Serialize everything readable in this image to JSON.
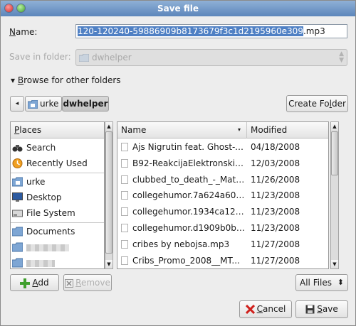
{
  "window": {
    "title": "Save file"
  },
  "name_field": {
    "label_u": "N",
    "label_rest": "ame:",
    "value_selected": "120-120240-59886909b8173679f3c1d2195960e309",
    "value_rest": ".mp3"
  },
  "save_in": {
    "label": "Save in folder:",
    "value": "dwhelper"
  },
  "browse": {
    "arrow": "▾",
    "label_u": "B",
    "label_rest": "rowse for other folders"
  },
  "pathbar": {
    "back_glyph": "◂",
    "crumbs": [
      "urke",
      "dwhelper"
    ]
  },
  "create_folder": {
    "label_a": "Create Fo",
    "label_u": "l",
    "label_b": "der"
  },
  "places": {
    "header_u": "P",
    "header_rest": "laces",
    "items": [
      "Search",
      "Recently Used",
      "urke",
      "Desktop",
      "File System",
      "Documents"
    ]
  },
  "files": {
    "col_name": "Name",
    "col_modified": "Modified",
    "sort_glyph": "▾",
    "rows": [
      {
        "name": "Ajs Nigrutin feat. Ghost-B...",
        "modified": "04/18/2008"
      },
      {
        "name": "B92-ReakcijaElektronskiZl...",
        "modified": "12/03/2008"
      },
      {
        "name": "clubbed_to_death_-_Matri...",
        "modified": "11/26/2008"
      },
      {
        "name": "collegehumor.7a624a605...",
        "modified": "11/23/2008"
      },
      {
        "name": "collegehumor.1934ca127...",
        "modified": "11/23/2008"
      },
      {
        "name": "collegehumor.d1909b0be...",
        "modified": "11/23/2008"
      },
      {
        "name": "cribes by nebojsa.mp3",
        "modified": "11/27/2008"
      },
      {
        "name": "Cribs_Promo_2008__MT...",
        "modified": "11/27/2008"
      }
    ]
  },
  "buttons": {
    "add_u": "A",
    "add_rest": "dd",
    "remove_u": "R",
    "remove_rest": "emove",
    "cancel_u": "C",
    "cancel_rest": "ancel",
    "save_u": "S",
    "save_rest": "ave"
  },
  "filter": {
    "value": "All Files",
    "glyph": "⬍"
  },
  "colors": {
    "title_bar": "#5c86bb",
    "selection": "#4f80c4",
    "cancel_icon": "#d0201c",
    "add_icon": "#3f9f2d"
  }
}
